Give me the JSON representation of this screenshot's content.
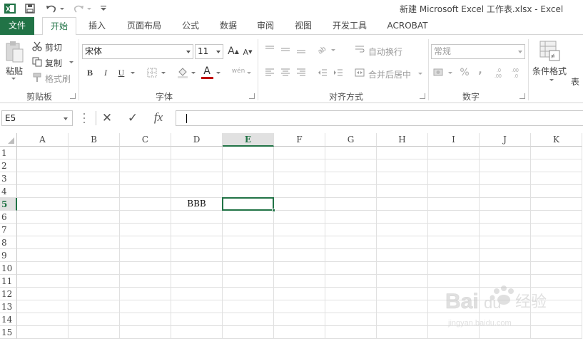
{
  "titlebar": {
    "title": "新建 Microsoft Excel 工作表.xlsx - Excel",
    "quick_access": [
      "excel-logo-icon",
      "save-icon",
      "undo-icon",
      "redo-icon",
      "customize-icon"
    ]
  },
  "tabs": [
    {
      "label": "文件"
    },
    {
      "label": "开始"
    },
    {
      "label": "插入"
    },
    {
      "label": "页面布局"
    },
    {
      "label": "公式"
    },
    {
      "label": "数据"
    },
    {
      "label": "审阅"
    },
    {
      "label": "视图"
    },
    {
      "label": "开发工具"
    },
    {
      "label": "ACROBAT"
    }
  ],
  "ribbon": {
    "clipboard": {
      "paste": "粘贴",
      "cut": "剪切",
      "copy": "复制",
      "format_painter": "格式刷",
      "group": "剪贴板"
    },
    "font": {
      "name": "宋体",
      "size": "11",
      "group": "字体",
      "bold": "B",
      "italic": "I",
      "underline": "U",
      "grow": "A",
      "shrink": "A",
      "font_color": "A",
      "phonetic": "wén"
    },
    "alignment": {
      "wrap": "自动换行",
      "merge": "合并后居中",
      "group": "对齐方式"
    },
    "number": {
      "format": "常规",
      "percent": "%",
      "comma": ",",
      "group": "数字"
    },
    "styles": {
      "conditional": "条件格式",
      "table_partial": "表"
    }
  },
  "formula_bar": {
    "name_box": "E5",
    "cancel": "✕",
    "enter": "✓",
    "fx": "fx",
    "value": ""
  },
  "sheet": {
    "columns": [
      "A",
      "B",
      "C",
      "D",
      "E",
      "F",
      "G",
      "H",
      "I",
      "J",
      "K"
    ],
    "rows": [
      "1",
      "2",
      "3",
      "4",
      "5",
      "6",
      "7",
      "8",
      "9",
      "10",
      "11",
      "12",
      "13",
      "14",
      "15"
    ],
    "selected_cell": "E5",
    "cells": {
      "D5": "BBB"
    }
  },
  "colors": {
    "accent": "#217346",
    "font_color_bar": "#c00000"
  },
  "watermark": {
    "text": "Bai 经验",
    "sub": "jingyan.baidu.com"
  }
}
